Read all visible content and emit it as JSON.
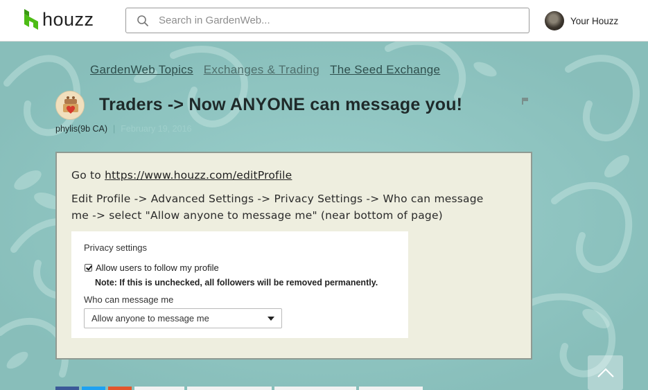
{
  "header": {
    "logo_text": "houzz",
    "search_placeholder": "Search in GardenWeb...",
    "account_label": "Your Houzz"
  },
  "breadcrumbs": [
    {
      "label": "GardenWeb Topics"
    },
    {
      "label": "Exchanges & Trading"
    },
    {
      "label": "The Seed Exchange"
    }
  ],
  "post": {
    "title": "Traders -> Now ANYONE can message you!",
    "author": "phylis(9b CA)",
    "date": "February 19, 2016",
    "line1_prefix": "Go to ",
    "line1_link": "https://www.houzz.com/editProfile",
    "line2": "Edit Profile -> Advanced Settings -> Privacy Settings -> Who can message",
    "line3": "me -> select \"Allow anyone to message me\" (near bottom of page)"
  },
  "privacy_screenshot": {
    "title": "Privacy settings",
    "checkbox_label": "Allow users to follow my profile",
    "checkbox_checked": true,
    "note": "Note: If this is unchecked, all followers will be removed permanently.",
    "who_label": "Who can message me",
    "select_value": "Allow anyone to message me"
  },
  "colors": {
    "background": "#90cac6",
    "post_box": "#eeeedf",
    "houzz_green": "#4dbc15"
  }
}
